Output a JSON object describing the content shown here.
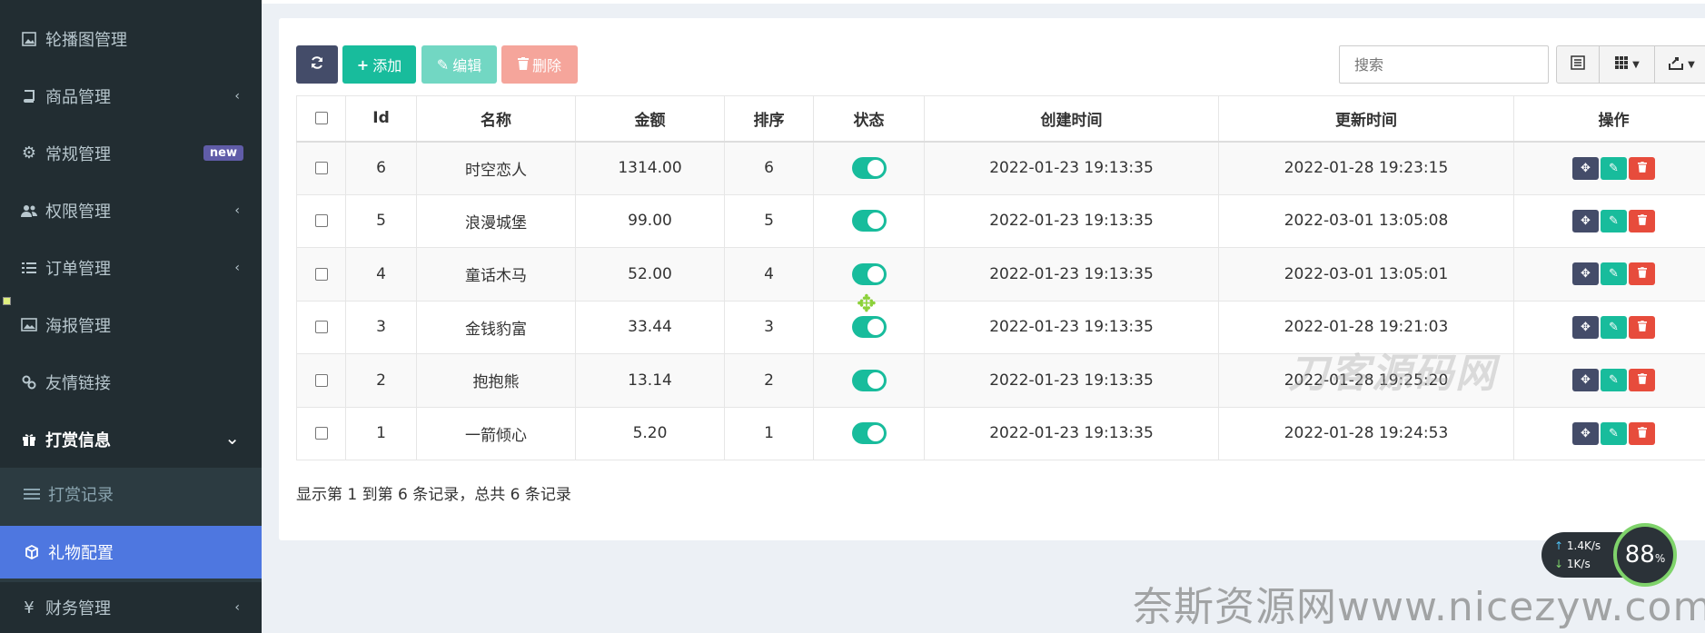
{
  "sidebar": {
    "items": [
      {
        "label": "轮播图管理",
        "icon": "image-icon",
        "chevron": ""
      },
      {
        "label": "商品管理",
        "icon": "book-icon",
        "chevron": "‹"
      },
      {
        "label": "常规管理",
        "icon": "gears-icon",
        "chevron": "",
        "badge": "new"
      },
      {
        "label": "权限管理",
        "icon": "users-icon",
        "chevron": "‹"
      },
      {
        "label": "订单管理",
        "icon": "list-icon",
        "chevron": "‹"
      },
      {
        "label": "海报管理",
        "icon": "picture-icon",
        "chevron": ""
      },
      {
        "label": "友情链接",
        "icon": "link-icon",
        "chevron": ""
      },
      {
        "label": "打赏信息",
        "icon": "gift-icon",
        "chevron": "⌄"
      },
      {
        "label": "财务管理",
        "icon": "yen-icon",
        "chevron": "‹"
      }
    ],
    "subitems": [
      {
        "label": "打赏记录",
        "icon": "list-icon"
      },
      {
        "label": "礼物配置",
        "icon": "cube-icon"
      }
    ]
  },
  "toolbar": {
    "add_label": "添加",
    "edit_label": "编辑",
    "delete_label": "删除",
    "search_placeholder": "搜索"
  },
  "table": {
    "headers": [
      "Id",
      "名称",
      "金额",
      "排序",
      "状态",
      "创建时间",
      "更新时间",
      "操作"
    ],
    "rows": [
      {
        "id": "6",
        "name": "时空恋人",
        "amount": "1314.00",
        "sort": "6",
        "created": "2022-01-23 19:13:35",
        "updated": "2022-01-28 19:23:15"
      },
      {
        "id": "5",
        "name": "浪漫城堡",
        "amount": "99.00",
        "sort": "5",
        "created": "2022-01-23 19:13:35",
        "updated": "2022-03-01 13:05:08"
      },
      {
        "id": "4",
        "name": "童话木马",
        "amount": "52.00",
        "sort": "4",
        "created": "2022-01-23 19:13:35",
        "updated": "2022-03-01 13:05:01"
      },
      {
        "id": "3",
        "name": "金钱豹富",
        "amount": "33.44",
        "sort": "3",
        "created": "2022-01-23 19:13:35",
        "updated": "2022-01-28 19:21:03"
      },
      {
        "id": "2",
        "name": "抱抱熊",
        "amount": "13.14",
        "sort": "2",
        "created": "2022-01-23 19:13:35",
        "updated": "2022-01-28 19:25:20"
      },
      {
        "id": "1",
        "name": "一箭倾心",
        "amount": "5.20",
        "sort": "1",
        "created": "2022-01-23 19:13:35",
        "updated": "2022-01-28 19:24:53"
      }
    ]
  },
  "pager": {
    "text": "显示第 1 到第 6 条记录，总共 6 条记录"
  },
  "overlay": {
    "watermark_main": "刀客源码网",
    "watermark_site": "奈斯资源网www.nicezyw.com",
    "net_up": "1.4K/s",
    "net_down": "1K/s",
    "gauge_value": "88",
    "gauge_unit": "%"
  },
  "colors": {
    "sidebar_bg": "#222d32",
    "accent": "#18bc9c",
    "active": "#4e77e0",
    "danger": "#e74c3c",
    "dark_btn": "#444c69"
  }
}
